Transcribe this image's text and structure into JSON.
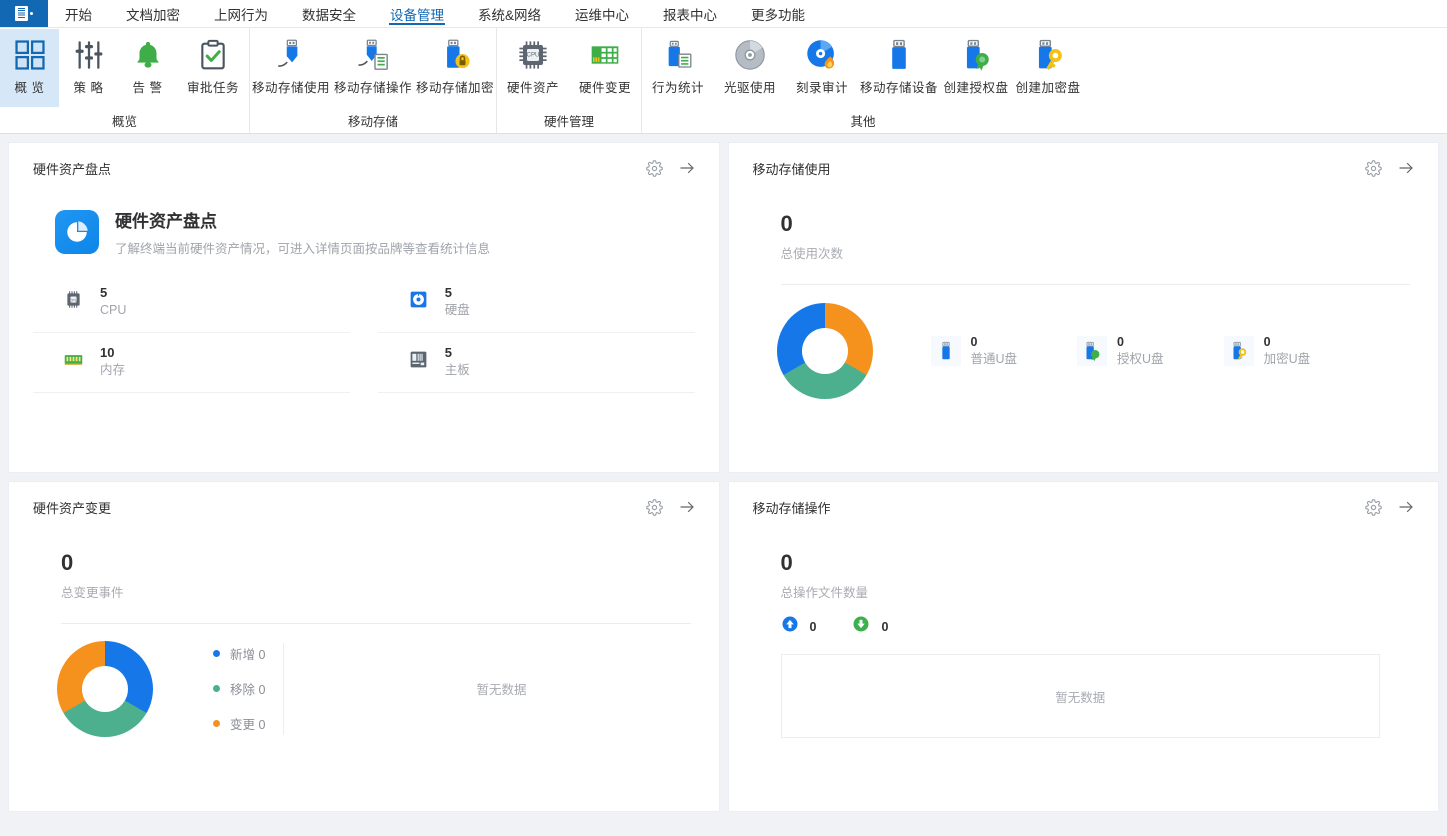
{
  "app": {
    "logo_icon": "app-logo-icon",
    "accent": "#1268b3"
  },
  "menu": {
    "items": [
      {
        "label": "开始",
        "active": false
      },
      {
        "label": "文档加密",
        "active": false
      },
      {
        "label": "上网行为",
        "active": false
      },
      {
        "label": "数据安全",
        "active": false
      },
      {
        "label": "设备管理",
        "active": true
      },
      {
        "label": "系统&网络",
        "active": false
      },
      {
        "label": "运维中心",
        "active": false
      },
      {
        "label": "报表中心",
        "active": false
      },
      {
        "label": "更多功能",
        "active": false
      }
    ]
  },
  "ribbon": {
    "groups": [
      {
        "label": "概览",
        "buttons": [
          {
            "label": "概 览",
            "icon": "overview-grid-icon",
            "selected": true
          },
          {
            "label": "策 略",
            "icon": "sliders-policy-icon",
            "selected": false
          },
          {
            "label": "告 警",
            "icon": "bell-alert-icon",
            "selected": false
          },
          {
            "label": "审批任务",
            "icon": "clipboard-check-icon",
            "selected": false
          }
        ]
      },
      {
        "label": "移动存储",
        "buttons": [
          {
            "label": "移动存储使用",
            "icon": "usb-download-icon",
            "selected": false
          },
          {
            "label": "移动存储操作",
            "icon": "usb-list-icon",
            "selected": false
          },
          {
            "label": "移动存储加密",
            "icon": "usb-lock-icon",
            "selected": false
          }
        ]
      },
      {
        "label": "硬件管理",
        "buttons": [
          {
            "label": "硬件资产",
            "icon": "cpu-chip-icon",
            "selected": false
          },
          {
            "label": "硬件变更",
            "icon": "memory-board-icon",
            "selected": false
          }
        ]
      },
      {
        "label": "其他",
        "buttons": [
          {
            "label": "行为统计",
            "icon": "usb-report-icon",
            "selected": false
          },
          {
            "label": "光驱使用",
            "icon": "disc-drive-icon",
            "selected": false
          },
          {
            "label": "刻录审计",
            "icon": "disc-burn-icon",
            "selected": false
          },
          {
            "label": "移动存储设备",
            "icon": "usb-device-icon",
            "selected": false
          },
          {
            "label": "创建授权盘",
            "icon": "usb-badge-icon",
            "selected": false
          },
          {
            "label": "创建加密盘",
            "icon": "usb-key-icon",
            "selected": false
          }
        ]
      }
    ]
  },
  "cards": {
    "hardware_inventory": {
      "title": "硬件资产盘点",
      "gear_icon": "gear-icon",
      "arrow_icon": "arrow-right-icon",
      "hero": {
        "icon": "pie-chart-app-icon",
        "heading": "硬件资产盘点",
        "description": "了解终端当前硬件资产情况，可进入详情页面按品牌等查看统计信息"
      },
      "stats": [
        {
          "value": "5",
          "label": "CPU",
          "icon": "cpu-icon"
        },
        {
          "value": "5",
          "label": "硬盘",
          "icon": "harddisk-icon"
        },
        {
          "value": "10",
          "label": "内存",
          "icon": "ram-icon"
        },
        {
          "value": "5",
          "label": "主板",
          "icon": "motherboard-icon"
        }
      ]
    },
    "removable_storage_usage": {
      "title": "移动存储使用",
      "gear_icon": "gear-icon",
      "arrow_icon": "arrow-right-icon",
      "total_value": "0",
      "total_label": "总使用次数",
      "usb_items": [
        {
          "value": "0",
          "label": "普通U盘",
          "icon": "usb-plain-icon"
        },
        {
          "value": "0",
          "label": "授权U盘",
          "icon": "usb-badge-icon"
        },
        {
          "value": "0",
          "label": "加密U盘",
          "icon": "usb-key-icon"
        }
      ]
    },
    "hardware_change": {
      "title": "硬件资产变更",
      "gear_icon": "gear-icon",
      "arrow_icon": "arrow-right-icon",
      "total_value": "0",
      "total_label": "总变更事件",
      "legend": [
        {
          "label": "新增",
          "value": "0",
          "color": "#1677e8"
        },
        {
          "label": "移除",
          "value": "0",
          "color": "#4caf8e"
        },
        {
          "label": "变更",
          "value": "0",
          "color": "#f5921e"
        }
      ],
      "no_data": "暂无数据"
    },
    "removable_storage_ops": {
      "title": "移动存储操作",
      "gear_icon": "gear-icon",
      "arrow_icon": "arrow-right-icon",
      "total_value": "0",
      "total_label": "总操作文件数量",
      "upload": {
        "icon": "arrow-up-circle-icon",
        "value": "0",
        "color": "#1677e8"
      },
      "download": {
        "icon": "arrow-down-circle-icon",
        "value": "0",
        "color": "#3cb04a"
      },
      "no_data": "暂无数据"
    }
  },
  "chart_data": [
    {
      "type": "pie",
      "name": "removable-storage-usage-donut",
      "title": "移动存储使用",
      "labels": [
        "普通U盘",
        "授权U盘",
        "加密U盘"
      ],
      "values": [
        0,
        0,
        0
      ],
      "display_fractions": [
        0.3333,
        0.3333,
        0.3334
      ],
      "colors": [
        "#f5921e",
        "#4caf8e",
        "#1677e8"
      ],
      "legend": "right",
      "donut": true
    },
    {
      "type": "pie",
      "name": "hardware-change-donut",
      "title": "硬件资产变更",
      "labels": [
        "新增",
        "移除",
        "变更"
      ],
      "values": [
        0,
        0,
        0
      ],
      "display_fractions": [
        0.3333,
        0.3333,
        0.3334
      ],
      "colors": [
        "#1677e8",
        "#4caf8e",
        "#f5921e"
      ],
      "legend": "right",
      "donut": true
    }
  ]
}
